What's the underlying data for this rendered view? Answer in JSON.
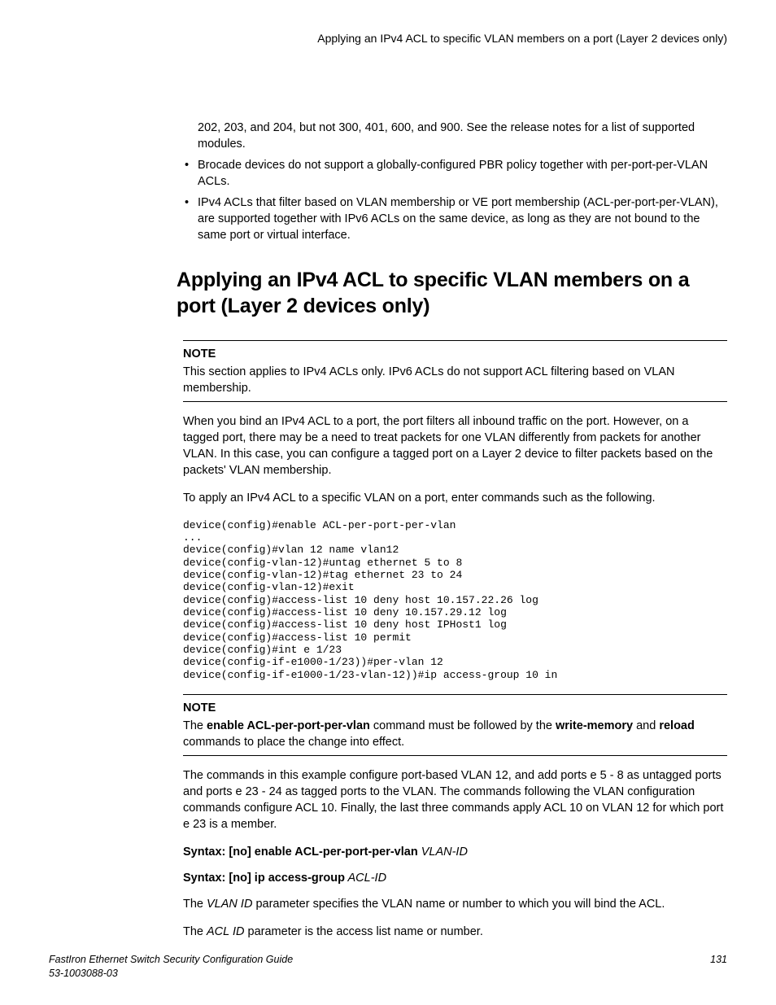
{
  "runningHeader": "Applying an IPv4 ACL to specific VLAN members on a port (Layer 2 devices only)",
  "topPara": "202, 203, and 204, but not 300, 401, 600, and 900. See the release notes for a list of supported modules.",
  "bullets": [
    "Brocade devices do not support a globally-configured PBR policy together with per-port-per-VLAN ACLs.",
    "IPv4 ACLs that filter based on VLAN membership or VE port membership (ACL-per-port-per-VLAN), are supported together with IPv6 ACLs on the same device, as long as they are not bound to the same port or virtual interface."
  ],
  "h1": "Applying an IPv4 ACL to specific VLAN members on a port (Layer 2 devices only)",
  "note1": {
    "label": "NOTE",
    "text": "This section applies to IPv4 ACLs only. IPv6 ACLs do not support ACL filtering based on VLAN membership."
  },
  "paraBind": "When you bind an IPv4 ACL to a port, the port filters all inbound traffic on the port. However, on a tagged port, there may be a need to treat packets for one VLAN differently from packets for another VLAN. In this case, you can configure a tagged port on a Layer 2 device to filter packets based on the packets' VLAN membership.",
  "paraApply": "To apply an IPv4 ACL to a specific VLAN on a port, enter commands such as the following.",
  "code": "device(config)#enable ACL-per-port-per-vlan\n...\ndevice(config)#vlan 12 name vlan12\ndevice(config-vlan-12)#untag ethernet 5 to 8\ndevice(config-vlan-12)#tag ethernet 23 to 24\ndevice(config-vlan-12)#exit\ndevice(config)#access-list 10 deny host 10.157.22.26 log\ndevice(config)#access-list 10 deny 10.157.29.12 log\ndevice(config)#access-list 10 deny host IPHost1 log\ndevice(config)#access-list 10 permit\ndevice(config)#int e 1/23\ndevice(config-if-e1000-1/23))#per-vlan 12\ndevice(config-if-e1000-1/23-vlan-12))#ip access-group 10 in",
  "note2": {
    "label": "NOTE",
    "pre": "The ",
    "b1": "enable ACL-per-port-per-vlan",
    "mid": " command must be followed by the ",
    "b2": "write-memory",
    "mid2": " and ",
    "b3": "reload",
    "post": " commands to place the change into effect."
  },
  "paraExample": "The commands in this example configure port-based VLAN 12, and add ports e 5 - 8 as untagged ports and ports e 23 - 24 as tagged ports to the VLAN. The commands following the VLAN configuration commands configure ACL 10. Finally, the last three commands apply ACL 10 on VLAN 12 for which port e 23 is a member.",
  "syntax1": {
    "b": "Syntax: [no] enable ACL-per-port-per-vlan",
    "i": " VLAN-ID"
  },
  "syntax2": {
    "b": "Syntax: [no] ip access-group",
    "i": " ACL-ID"
  },
  "paraVlanId": {
    "pre": "The ",
    "i": "VLAN ID",
    "post": " parameter specifies the VLAN name or number to which you will bind the ACL."
  },
  "paraAclId": {
    "pre": "The ",
    "i": "ACL ID",
    "post": " parameter is the access list name or number."
  },
  "footer": {
    "title": "FastIron Ethernet Switch Security Configuration Guide",
    "id": "53-1003088-03",
    "page": "131"
  }
}
